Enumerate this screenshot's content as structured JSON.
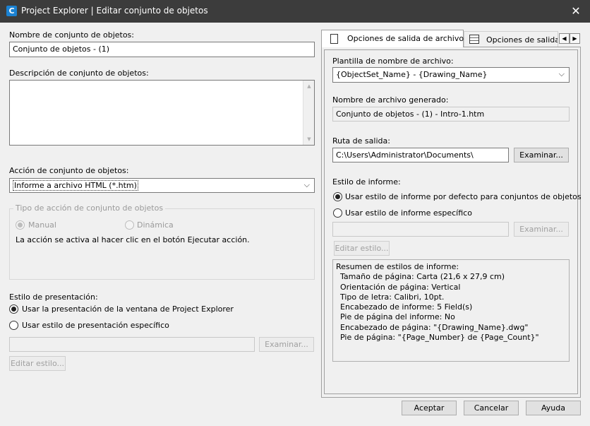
{
  "window": {
    "title": "Project Explorer | Editar conjunto de objetos",
    "app_icon": "C"
  },
  "left": {
    "name_label": "Nombre de conjunto de objetos:",
    "name_value": "Conjunto de objetos - (1)",
    "desc_label": "Descripción de conjunto de objetos:",
    "desc_value": "",
    "action_label": "Acción de conjunto de objetos:",
    "action_value": "Informe a archivo HTML (*.htm)",
    "action_type": {
      "title": "Tipo de acción de conjunto de objetos",
      "manual": "Manual",
      "dynamic": "Dinámica",
      "note": "La acción se activa al hacer clic en el botón Ejecutar acción."
    },
    "presentation": {
      "label": "Estilo de presentación:",
      "option_explorer": "Usar la presentación de la ventana de Project Explorer",
      "option_specific": "Usar estilo de presentación específico",
      "path_value": "",
      "browse": "Examinar...",
      "edit": "Editar estilo..."
    }
  },
  "tabs": [
    {
      "label": "Opciones de salida de archivo",
      "icon": "document-icon",
      "active": true
    },
    {
      "label": "Opciones de salida",
      "icon": "table-icon",
      "active": false
    }
  ],
  "right": {
    "template_label": "Plantilla de nombre de archivo:",
    "template_value": "{ObjectSet_Name} - {Drawing_Name}",
    "generated_label": "Nombre de archivo generado:",
    "generated_value": "Conjunto de objetos - (1) - Intro-1.htm",
    "output_label": "Ruta de salida:",
    "output_value": "C:\\Users\\Administrator\\Documents\\",
    "browse": "Examinar...",
    "report_style_label": "Estilo de informe:",
    "report_option_default": "Usar estilo de informe por defecto para conjuntos de objetos",
    "report_option_specific": "Usar estilo de informe específico",
    "report_path_value": "",
    "report_browse": "Examinar...",
    "report_edit": "Editar estilo...",
    "summary": [
      "Resumen de estilos de informe:",
      "Tamaño de página: Carta (21,6 x 27,9 cm)",
      "Orientación de página: Vertical",
      "Tipo de letra: Calibri, 10pt.",
      "Encabezado de informe: 5 Field(s)",
      "Pie de página del informe: No",
      "Encabezado de página: \"{Drawing_Name}.dwg\"",
      "Pie de página: \"{Page_Number} de {Page_Count}\""
    ]
  },
  "footer": {
    "accept": "Aceptar",
    "cancel": "Cancelar",
    "help": "Ayuda"
  }
}
